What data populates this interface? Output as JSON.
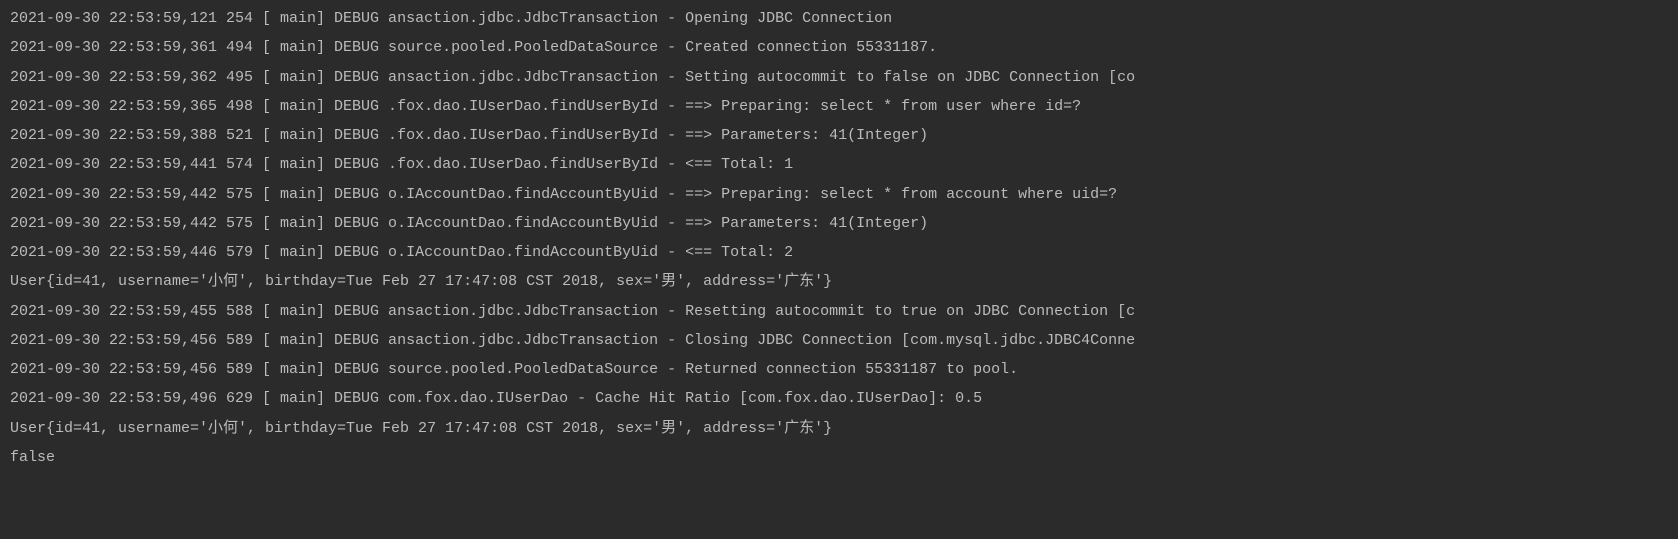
{
  "lines": [
    "2021-09-30 22:53:59,121 254    [           main] DEBUG ansaction.jdbc.JdbcTransaction  - Opening JDBC Connection",
    "2021-09-30 22:53:59,361 494    [           main] DEBUG source.pooled.PooledDataSource  - Created connection 55331187.",
    "2021-09-30 22:53:59,362 495    [           main] DEBUG ansaction.jdbc.JdbcTransaction  - Setting autocommit to false on JDBC Connection [co",
    "2021-09-30 22:53:59,365 498    [           main] DEBUG .fox.dao.IUserDao.findUserById  - ==>  Preparing: select * from user where id=?",
    "2021-09-30 22:53:59,388 521    [           main] DEBUG .fox.dao.IUserDao.findUserById  - ==> Parameters: 41(Integer)",
    "2021-09-30 22:53:59,441 574    [           main] DEBUG .fox.dao.IUserDao.findUserById  - <==      Total: 1",
    "2021-09-30 22:53:59,442 575    [           main] DEBUG o.IAccountDao.findAccountByUid  - ==>  Preparing: select * from account where uid=?",
    "2021-09-30 22:53:59,442 575    [           main] DEBUG o.IAccountDao.findAccountByUid  - ==> Parameters: 41(Integer)",
    "2021-09-30 22:53:59,446 579    [           main] DEBUG o.IAccountDao.findAccountByUid  - <==      Total: 2",
    "User{id=41, username='小何', birthday=Tue Feb 27 17:47:08 CST 2018, sex='男', address='广东'}",
    "2021-09-30 22:53:59,455 588    [           main] DEBUG ansaction.jdbc.JdbcTransaction  - Resetting autocommit to true on JDBC Connection [c",
    "2021-09-30 22:53:59,456 589    [           main] DEBUG ansaction.jdbc.JdbcTransaction  - Closing JDBC Connection [com.mysql.jdbc.JDBC4Conne",
    "2021-09-30 22:53:59,456 589    [           main] DEBUG source.pooled.PooledDataSource  - Returned connection 55331187 to pool.",
    "2021-09-30 22:53:59,496 629    [           main] DEBUG        com.fox.dao.IUserDao  - Cache Hit Ratio [com.fox.dao.IUserDao]: 0.5",
    "User{id=41, username='小何', birthday=Tue Feb 27 17:47:08 CST 2018, sex='男', address='广东'}",
    "false"
  ]
}
